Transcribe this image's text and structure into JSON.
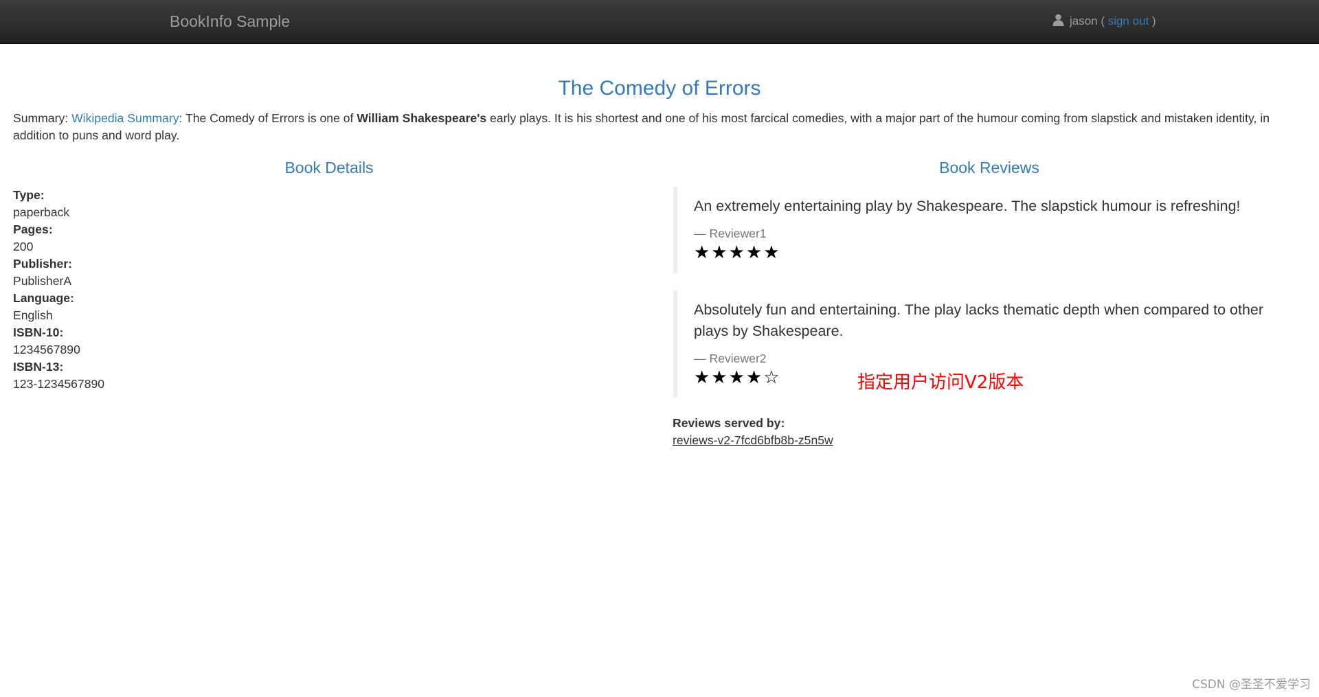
{
  "navbar": {
    "brand": "BookInfo Sample",
    "user_icon": "user-icon",
    "username": "jason",
    "open_paren": " ( ",
    "signout": "sign out",
    "close_paren": " )"
  },
  "book": {
    "title": "The Comedy of Errors",
    "summary_prefix": "Summary: ",
    "summary_link": "Wikipedia Summary",
    "summary_text_1": ": The Comedy of Errors is one of ",
    "summary_bold": "William Shakespeare's",
    "summary_text_2": " early plays. It is his shortest and one of his most farcical comedies, with a major part of the humour coming from slapstick and mistaken identity, in addition to puns and word play."
  },
  "details": {
    "heading": "Book Details",
    "fields": [
      {
        "label": "Type:",
        "value": "paperback"
      },
      {
        "label": "Pages:",
        "value": "200"
      },
      {
        "label": "Publisher:",
        "value": "PublisherA"
      },
      {
        "label": "Language:",
        "value": "English"
      },
      {
        "label": "ISBN-10:",
        "value": "1234567890"
      },
      {
        "label": "ISBN-13:",
        "value": "123-1234567890"
      }
    ]
  },
  "reviews": {
    "heading": "Book Reviews",
    "items": [
      {
        "text": "An extremely entertaining play by Shakespeare. The slapstick humour is refreshing!",
        "reviewer": "— Reviewer1",
        "stars": "★★★★★",
        "rating": 5
      },
      {
        "text": "Absolutely fun and entertaining. The play lacks thematic depth when compared to other plays by Shakespeare.",
        "reviewer": "— Reviewer2",
        "stars": "★★★★☆",
        "rating": 4
      }
    ],
    "served_by_label": "Reviews served by:",
    "served_by_pod": "reviews-v2-7fcd6bfb8b-z5n5w"
  },
  "annotation": "指定用户访问V2版本",
  "watermark": "CSDN @圣圣不爱学习",
  "colors": {
    "navbar_bg": "#222222",
    "link": "#337ab7",
    "annotation": "#ff0000"
  }
}
